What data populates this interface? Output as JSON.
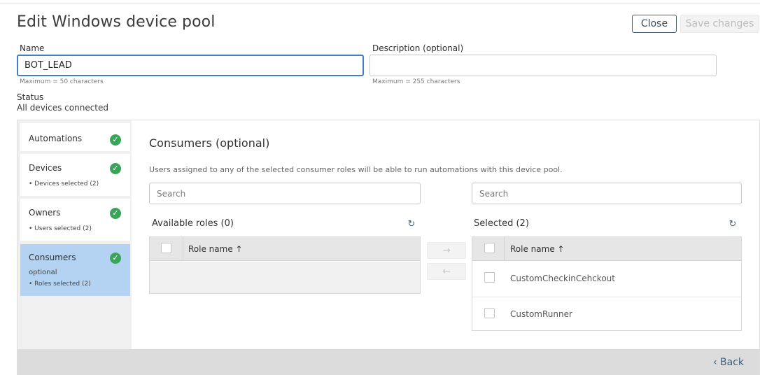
{
  "page": {
    "title": "Edit Windows device pool",
    "close_label": "Close",
    "save_label": "Save changes"
  },
  "form": {
    "name_label": "Name",
    "name_value": "BOT_LEAD",
    "name_hint": "Maximum = 50 characters",
    "description_label": "Description (optional)",
    "description_value": "",
    "description_hint": "Maximum = 255 characters",
    "status_label": "Status",
    "status_value": "All devices connected"
  },
  "steps": [
    {
      "title": "Automations",
      "sub": "",
      "opt": "",
      "icon": "check-circle-icon"
    },
    {
      "title": "Devices",
      "sub": "• Devices selected (2)",
      "opt": "",
      "icon": "check-circle-icon"
    },
    {
      "title": "Owners",
      "sub": "• Users selected (2)",
      "opt": "",
      "icon": "check-circle-icon"
    },
    {
      "title": "Consumers",
      "opt": "optional",
      "sub": "• Roles selected (2)",
      "icon": "check-circle-icon"
    }
  ],
  "consumers": {
    "title": "Consumers (optional)",
    "description": "Users assigned to any of the selected consumer roles will be able to run automations with this device pool.",
    "available": {
      "search_placeholder": "Search",
      "title": "Available roles (0)",
      "column": "Role name ↑",
      "rows": []
    },
    "selected": {
      "search_placeholder": "Search",
      "title": "Selected (2)",
      "column": "Role name ↑",
      "rows": [
        "CustomCheckinCehckout",
        "CustomRunner"
      ]
    },
    "move_right": "→",
    "move_left": "←"
  },
  "footer": {
    "back_label": "‹  Back"
  },
  "colors": {
    "accent": "#3f7fc8",
    "active_step": "#b4d2f2",
    "success": "#3aa55a"
  }
}
